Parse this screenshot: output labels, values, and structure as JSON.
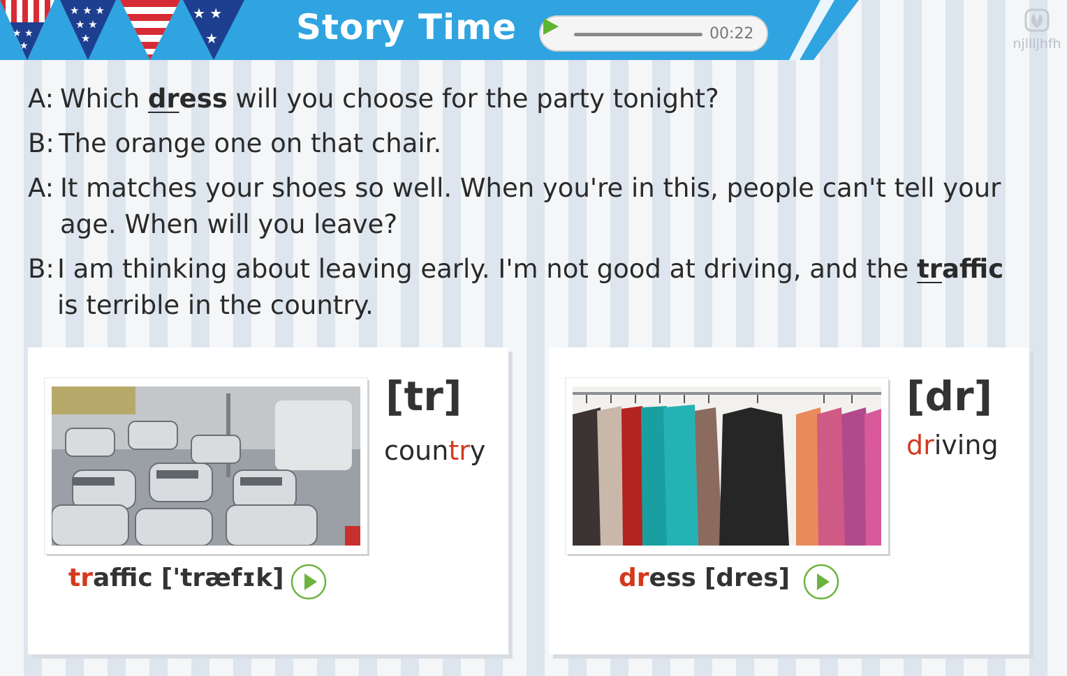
{
  "header": {
    "title": "Story Time"
  },
  "audio": {
    "time": "00:22"
  },
  "watermark": {
    "text": "njllljhfh"
  },
  "dialogue": [
    {
      "speaker": "A:",
      "parts": [
        {
          "t": "Which "
        },
        {
          "t": "dr",
          "kw": true,
          "ul": true
        },
        {
          "t": "ess",
          "kw": true
        },
        {
          "t": " will you choose for the party tonight?"
        }
      ]
    },
    {
      "speaker": "B:",
      "parts": [
        {
          "t": "The orange one on that chair."
        }
      ]
    },
    {
      "speaker": "A:",
      "parts": [
        {
          "t": "It matches your shoes so well. When you're in this, people can't tell your age. When will you leave?"
        }
      ]
    },
    {
      "speaker": "B:",
      "parts": [
        {
          "t": "I am thinking about leaving early. I'm not good at driving, and the "
        },
        {
          "t": "tr",
          "kw": true,
          "ul": true
        },
        {
          "t": "affic",
          "kw": true
        },
        {
          "t": " is terrible in the country."
        }
      ]
    }
  ],
  "cards": {
    "left": {
      "phoneme": "[tr]",
      "example_pre": "coun",
      "example_hl": "tr",
      "example_post": "y",
      "word_hl": "tr",
      "word_rest": "affic",
      "ipa": "['træfɪk]",
      "photo": "traffic-photo"
    },
    "right": {
      "phoneme": "[dr]",
      "example_pre": "",
      "example_hl": "dr",
      "example_post": "iving",
      "word_hl": "dr",
      "word_rest": "ess",
      "ipa": "[dres]",
      "photo": "dresses-photo"
    }
  },
  "colors": {
    "header_blue": "#2fa4e0",
    "highlight_red": "#d3391e",
    "play_green": "#6db33f"
  }
}
